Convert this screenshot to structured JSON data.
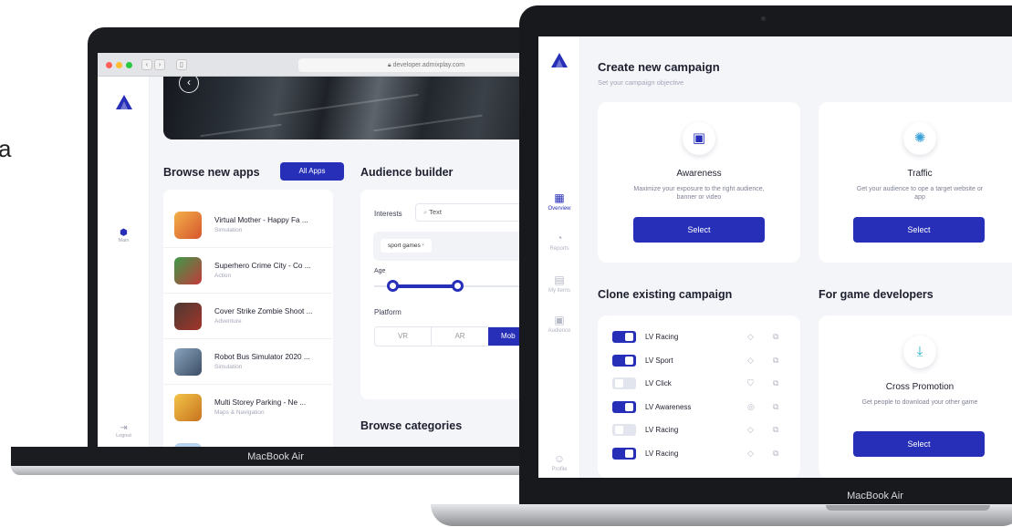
{
  "edge_text": "a",
  "left_laptop": {
    "browser": {
      "url": "developer.admixplay.com"
    },
    "sidebar": {
      "main_label": "Main",
      "logout_label": "Logout"
    },
    "browse_apps": {
      "title": "Browse new apps",
      "button": "All Apps",
      "apps": [
        {
          "name": "Virtual Mother - Happy Fa ...",
          "category": "Simulation",
          "color": "#e8933a"
        },
        {
          "name": "Superhero Crime City - Co ...",
          "category": "Action",
          "color": "#c73a3a"
        },
        {
          "name": "Cover Strike Zombie Shoot ...",
          "category": "Adventure",
          "color": "#8a2d25"
        },
        {
          "name": "Robot Bus Simulator 2020 ...",
          "category": "Simulation",
          "color": "#5c7390"
        },
        {
          "name": "Multi Storey Parking - Ne ...",
          "category": "Maps & Navigation",
          "color": "#e0a22c"
        }
      ]
    },
    "audience": {
      "title": "Audience builder",
      "interests_label": "Interests",
      "search_value": "Text",
      "tag": "sport games",
      "age_label": "Age",
      "platform_label": "Platform",
      "platforms": [
        "VR",
        "AR",
        "Mob"
      ]
    },
    "browse_categories": "Browse categories",
    "brand": "MacBook Air"
  },
  "right_laptop": {
    "sidebar": [
      {
        "label": "Overview",
        "icon": "grid-icon"
      },
      {
        "label": "Reports",
        "icon": "reports-icon"
      },
      {
        "label": "My items",
        "icon": "items-icon"
      },
      {
        "label": "Audience",
        "icon": "audience-icon"
      },
      {
        "label": "Profile",
        "icon": "profile-icon"
      }
    ],
    "header": {
      "title": "Create new campaign",
      "subtitle": "Set your campaign objective"
    },
    "objectives": [
      {
        "title": "Awareness",
        "desc": "Maximize your exposure to the right audience, banner or video",
        "button": "Select"
      },
      {
        "title": "Traffic",
        "desc": "Get your audience to ope a target website or app",
        "button": "Select"
      }
    ],
    "clone": {
      "title": "Clone existing campaign",
      "rows": [
        {
          "name": "LV Racing",
          "on": true
        },
        {
          "name": "LV Sport",
          "on": true
        },
        {
          "name": "LV Click",
          "on": false
        },
        {
          "name": "LV Awareness",
          "on": true
        },
        {
          "name": "LV Racing",
          "on": false
        },
        {
          "name": "LV Racing",
          "on": true
        }
      ]
    },
    "developers": {
      "title": "For game developers",
      "card_title": "Cross Promotion",
      "card_desc": "Get people to download your other game",
      "button": "Select"
    },
    "brand": "MacBook Air"
  },
  "colors": {
    "accent": "#272fb8",
    "background": "#f4f5f9"
  }
}
